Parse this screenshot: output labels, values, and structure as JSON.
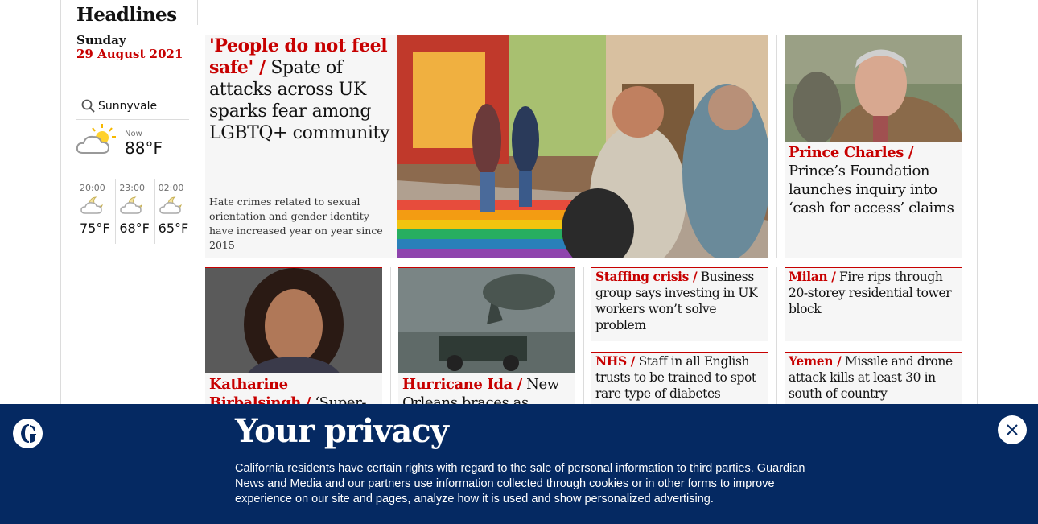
{
  "headlines": {
    "title": "Headlines",
    "day": "Sunday",
    "date": "29 August 2021"
  },
  "weather": {
    "location": "Sunnyvale",
    "now_label": "Now",
    "now_temp": "88°F",
    "forecast": [
      {
        "time": "20:00",
        "temp": "75°F"
      },
      {
        "time": "23:00",
        "temp": "68°F"
      },
      {
        "time": "02:00",
        "temp": "65°F"
      }
    ]
  },
  "main_story": {
    "kicker": "'People do not feel safe' /",
    "headline": "Spate of attacks across UK sparks fear among LGBTQ+ community",
    "standfirst": "Hate crimes related to sexual orientation and gender identity have increased year on year since 2015"
  },
  "stories": [
    {
      "kicker": "Prince Charles /",
      "headline": "Prince’s Foundation launches inquiry into ‘cash for access’ claims"
    },
    {
      "kicker": "Katharine Birbalsingh /",
      "headline": "‘Super-"
    },
    {
      "kicker": "Hurricane Ida /",
      "headline": "New Orleans braces as"
    },
    {
      "kicker": "Staffing crisis /",
      "headline": "Business group says investing in UK workers won’t solve problem"
    },
    {
      "kicker": "Milan /",
      "headline": "Fire rips through 20-storey residential tower block"
    },
    {
      "kicker": "NHS /",
      "headline": "Staff in all English trusts to be trained to spot rare type of diabetes"
    },
    {
      "kicker": "Yemen /",
      "headline": "Missile and drone attack kills at least 30 in south of country"
    }
  ],
  "privacy": {
    "title": "Your privacy",
    "text": "California residents have certain rights with regard to the sale of personal information to third parties. Guardian News and Media and our partners use information collected through cookies or in other forms to improve experience on our site and pages, analyze how it is used and show personalized advertising."
  },
  "colors": {
    "accent": "#c70000",
    "privacy_bg": "#052962",
    "card_bg": "#f6f6f6"
  },
  "icons": [
    "search-icon",
    "partly-sunny-icon",
    "night-cloudy-icon",
    "guardian-logo",
    "close-icon"
  ]
}
